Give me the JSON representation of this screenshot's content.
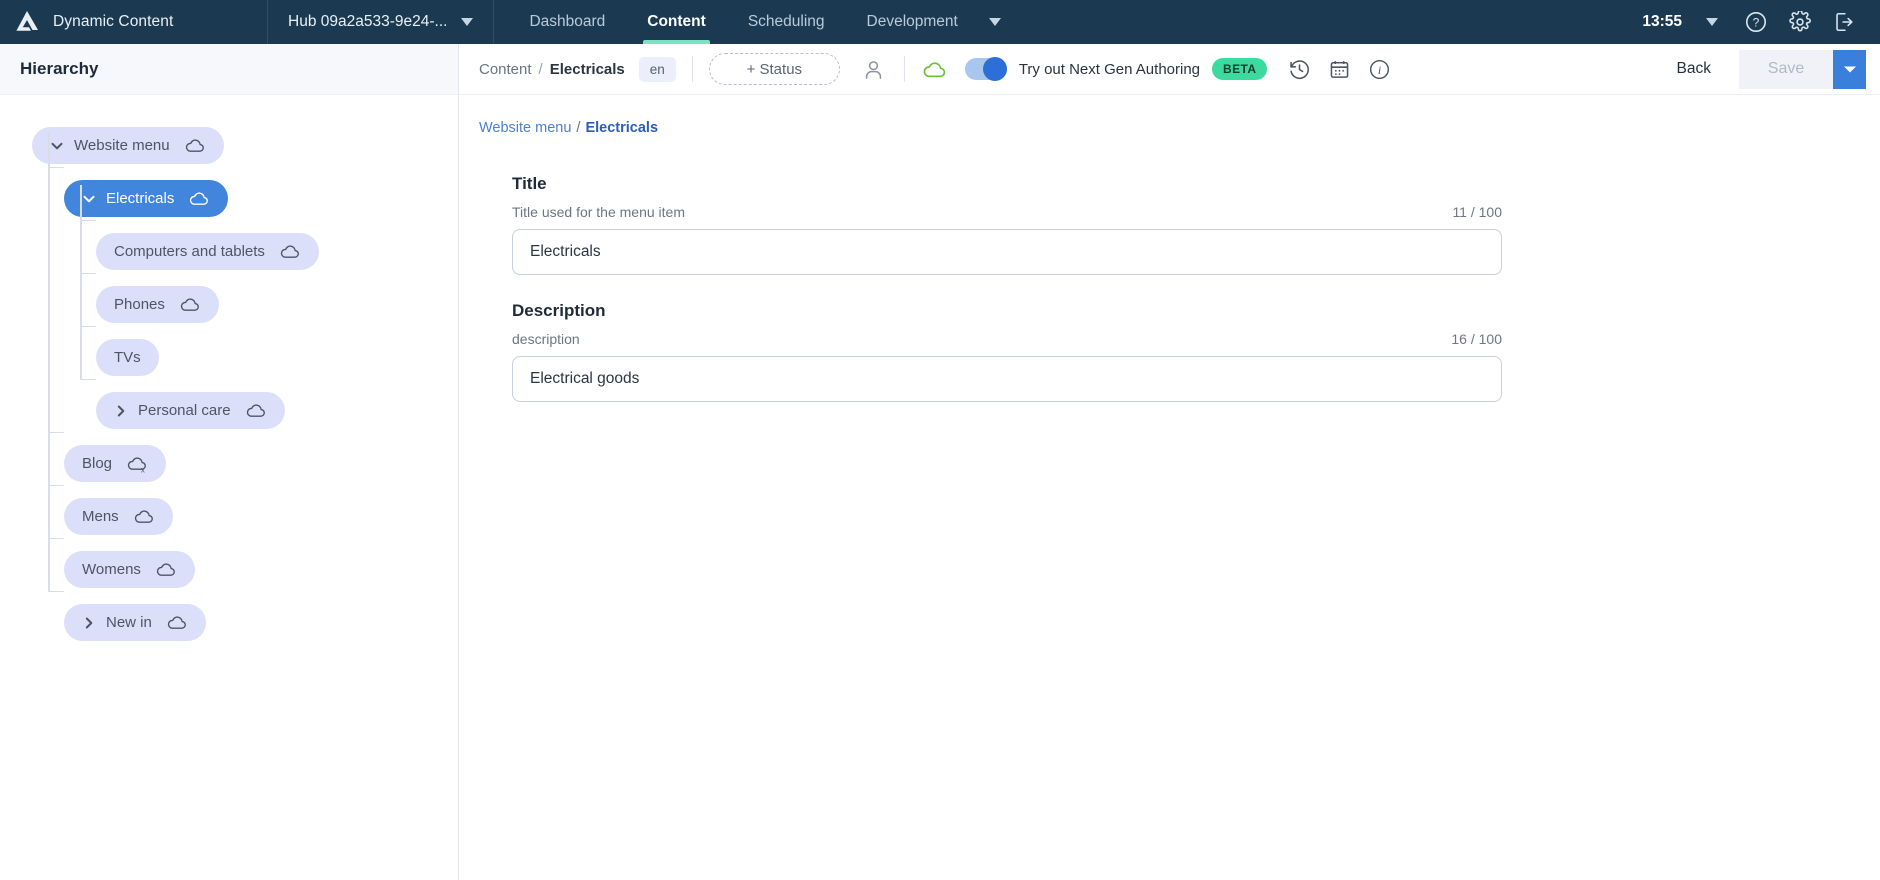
{
  "topnav": {
    "brand": "Dynamic Content",
    "logo_icon": "amplience-logo-icon",
    "hub": {
      "label": "Hub 09a2a533-9e24-...",
      "caret_icon": "chevron-down-icon"
    },
    "tabs": [
      {
        "label": "Dashboard",
        "active": false
      },
      {
        "label": "Content",
        "active": true
      },
      {
        "label": "Scheduling",
        "active": false
      },
      {
        "label": "Development",
        "active": false
      }
    ],
    "overflow_icon": "chevron-down-icon",
    "clock": "13:55",
    "clock_caret_icon": "chevron-down-icon",
    "help_icon": "help-circle-icon",
    "settings_icon": "gear-icon",
    "logout_icon": "logout-icon",
    "accent_underline": "#7ae3bf",
    "background": "#1b3a52"
  },
  "sidebar": {
    "title": "Hierarchy",
    "nodes": [
      {
        "label": "Website menu",
        "depth": 0,
        "chevron": "chevron-down-icon",
        "cloud": "cloud-icon",
        "selected": false
      },
      {
        "label": "Electricals",
        "depth": 1,
        "chevron": "chevron-down-icon",
        "cloud": "cloud-icon",
        "selected": true
      },
      {
        "label": "Computers and tablets",
        "depth": 2,
        "chevron": null,
        "cloud": "cloud-icon",
        "selected": false
      },
      {
        "label": "Phones",
        "depth": 2,
        "chevron": null,
        "cloud": "cloud-icon",
        "selected": false
      },
      {
        "label": "TVs",
        "depth": 2,
        "chevron": null,
        "cloud": null,
        "selected": false
      },
      {
        "label": "Personal care",
        "depth": 2,
        "chevron": "chevron-right-icon",
        "cloud": "cloud-icon",
        "selected": false
      },
      {
        "label": "Blog",
        "depth": 1,
        "chevron": null,
        "cloud": "cloud-off-icon",
        "selected": false
      },
      {
        "label": "Mens",
        "depth": 1,
        "chevron": null,
        "cloud": "cloud-icon",
        "selected": false
      },
      {
        "label": "Womens",
        "depth": 1,
        "chevron": null,
        "cloud": "cloud-icon",
        "selected": false
      },
      {
        "label": "New in",
        "depth": 1,
        "chevron": "chevron-right-icon",
        "cloud": "cloud-icon",
        "selected": false
      }
    ],
    "selected_color": "#4285dd",
    "pill_color": "#dcdffa"
  },
  "toolbar": {
    "breadcrumb_root": "Content",
    "breadcrumb_sep": "/",
    "breadcrumb_current": "Electricals",
    "language_badge": "en",
    "status_button": "+ Status",
    "user_icon": "user-icon",
    "publish_cloud_icon": "cloud-published-icon",
    "toggle_icon": "toggle-switch-on",
    "nextgen_label": "Try out Next Gen Authoring",
    "beta_badge": "BETA",
    "history_icon": "history-clock-icon",
    "calendar_icon": "calendar-icon",
    "info_icon": "info-circle-icon",
    "back_button": "Back",
    "save_button": "Save",
    "save_caret_icon": "chevron-down-icon",
    "beta_color": "#3ddaa0",
    "primary_color": "#3a7fdc"
  },
  "content": {
    "breadcrumb_root": "Website menu",
    "breadcrumb_sep": "/",
    "breadcrumb_current": "Electricals",
    "fields": [
      {
        "title": "Title",
        "help": "Title used for the menu item",
        "count": "11 / 100",
        "value": "Electricals",
        "placeholder": ""
      },
      {
        "title": "Description",
        "help": "description",
        "count": "16 / 100",
        "value": "Electrical goods",
        "placeholder": ""
      }
    ]
  }
}
